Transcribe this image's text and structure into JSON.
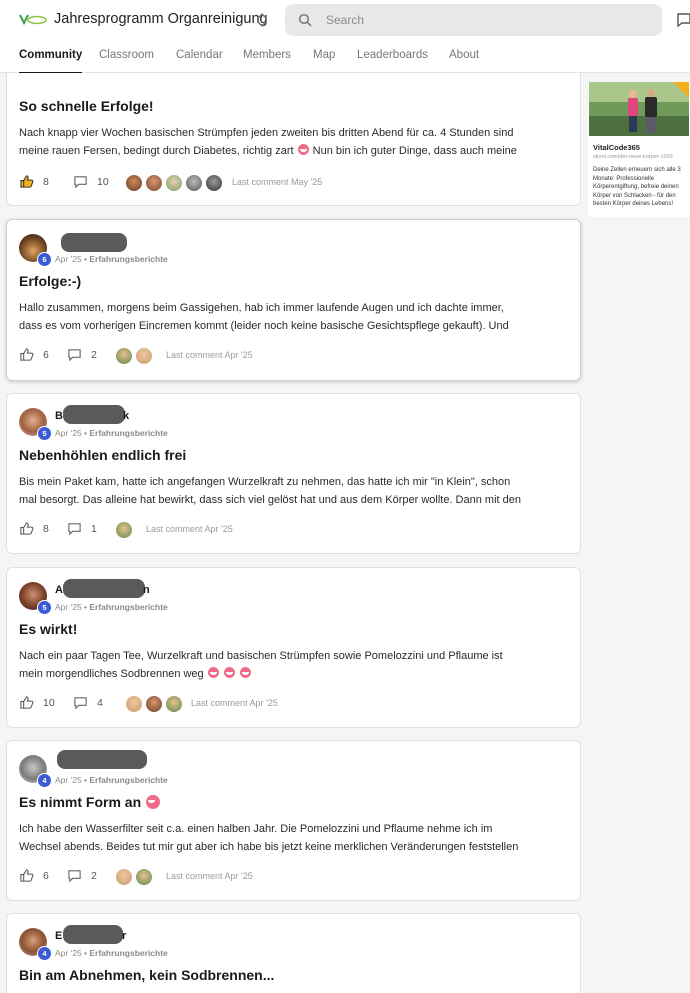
{
  "header": {
    "title": "Jahresprogramm Organreinigung",
    "search_placeholder": "Search"
  },
  "tabs": [
    "Community",
    "Classroom",
    "Calendar",
    "Members",
    "Map",
    "Leaderboards",
    "About"
  ],
  "posts": [
    {
      "title": "So schnelle Erfolge!",
      "body_line1": "Nach knapp vier Wochen basischen Strümpfen jeden zweiten bis dritten Abend für ca. 4 Stunden sind",
      "body_line2a": "meine rauen Fersen, bedingt durch Diabetes, richtig zart",
      "body_line2b": "Nun bin ich guter Dinge, dass auch meine",
      "likes": "8",
      "comments": "10",
      "last_comment": "Last comment May '25"
    },
    {
      "name": "",
      "level": "6",
      "date": "Apr '25",
      "category": "Erfahrungsberichte",
      "title": "Erfolge:-)",
      "body_line1": "Hallo zusammen, morgens beim Gassigehen, hab ich immer laufende Augen und ich dachte immer,",
      "body_line2": "dass es vom vorherigen Eincremen kommt (leider noch keine basische Gesichtspflege gekauft). Und",
      "likes": "6",
      "comments": "2",
      "last_comment": "Last comment Apr '25"
    },
    {
      "name_start": "B",
      "name_end": "k",
      "level": "5",
      "date": "Apr '25",
      "category": "Erfahrungsberichte",
      "title": "Nebenhöhlen endlich frei",
      "body_line1": "Bis mein Paket kam, hatte ich angefangen Wurzelkraft zu nehmen, das hatte ich mir \"in Klein\", schon",
      "body_line2": "mal besorgt. Das alleine hat bewirkt, dass sich viel gelöst hat und aus dem Körper wollte. Dann mit den",
      "likes": "8",
      "comments": "1",
      "last_comment": "Last comment Apr '25"
    },
    {
      "name_start": "A",
      "name_end": "n",
      "level": "5",
      "date": "Apr '25",
      "category": "Erfahrungsberichte",
      "title": "Es wirkt!",
      "body_line1": "Nach ein paar Tagen Tee, Wurzelkraft und basischen Strümpfen sowie Pomelozzini und Pflaume ist",
      "body_line2": "mein morgendliches Sodbrennen weg",
      "likes": "10",
      "comments": "4",
      "last_comment": "Last comment Apr '25"
    },
    {
      "name": "",
      "level": "4",
      "date": "Apr '25",
      "category": "Erfahrungsberichte",
      "title": "Es nimmt Form an",
      "body_line1": "Ich habe den Wasserfilter seit c.a. einen halben Jahr. Die Pomelozzini und Pflaume nehme ich im",
      "body_line2": "Wechsel abends. Beides tut mir gut aber ich habe bis jetzt keine merklichen Veränderungen feststellen",
      "likes": "6",
      "comments": "2",
      "last_comment": "Last comment Apr '25"
    },
    {
      "name_start": "E",
      "name_end": "r",
      "level": "4",
      "date": "Apr '25",
      "category": "Erfahrungsberichte",
      "title": "Bin am Abnehmen, kein Sodbrennen..."
    }
  ],
  "ad": {
    "name": "VitalCode365",
    "url": "skool.com/der-neue-korper-1026",
    "description": "Deine Zellen erneuern sich alle 3 Monate: Professionelle Körperentgiftung, befreie deinen Körper von Schlacken - für den besten Körper deines Lebens!"
  },
  "colors": {
    "accent": "#3b5bd6",
    "tab_active": "#1a1a1a",
    "redaction": "#5a5a5a"
  }
}
